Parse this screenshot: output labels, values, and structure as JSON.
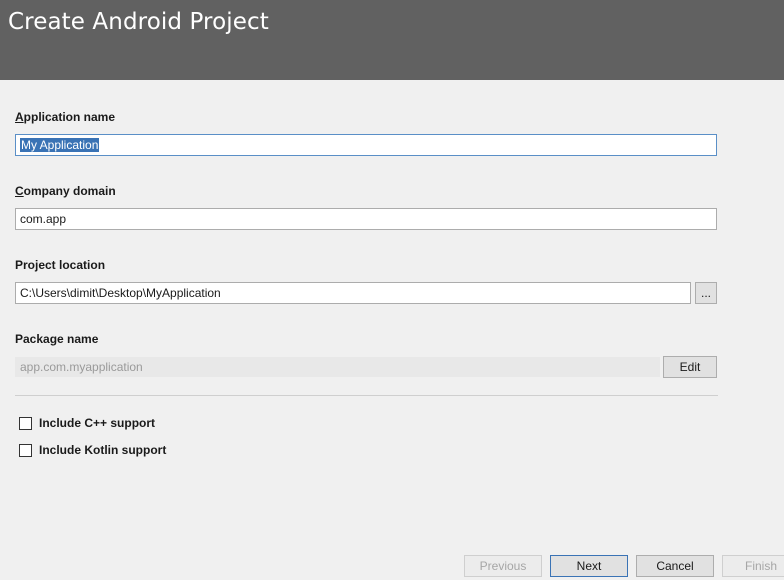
{
  "header": {
    "title": "Create Android Project"
  },
  "form": {
    "app_name": {
      "label_mnemonic": "A",
      "label_rest": "pplication name",
      "value": "My Application"
    },
    "company_domain": {
      "label_mnemonic": "C",
      "label_rest": "ompany domain",
      "value": "com.app"
    },
    "project_location": {
      "label": "Project location",
      "value": "C:\\Users\\dimit\\Desktop\\MyApplication",
      "browse_label": "..."
    },
    "package_name": {
      "label": "Package name",
      "value": "app.com.myapplication",
      "edit_label": "Edit"
    },
    "include_cpp": {
      "label": "Include C++ support",
      "checked": false
    },
    "include_kotlin": {
      "label": "Include Kotlin support",
      "checked": false
    }
  },
  "footer": {
    "previous_label": "Previous",
    "next_label": "Next",
    "cancel_label": "Cancel",
    "finish_label": "Finish"
  },
  "colors": {
    "header_bg": "#616161",
    "focus_border": "#5a8fc7",
    "selection": "#3a73b5"
  }
}
